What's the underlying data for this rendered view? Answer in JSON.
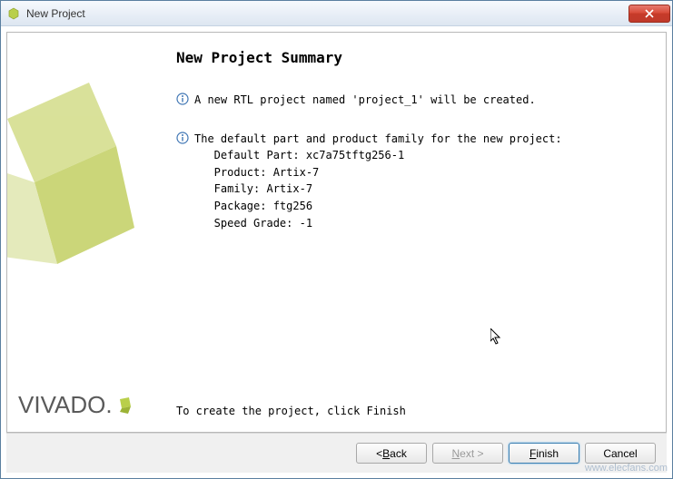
{
  "window": {
    "title": "New Project"
  },
  "content": {
    "heading": "New Project Summary",
    "info1": "A new RTL project named 'project_1' will be created.",
    "info2_line1": "The default part and product family for the new project:",
    "info2_default_part": "   Default Part: xc7a75tftg256-1",
    "info2_product": "   Product: Artix-7",
    "info2_family": "   Family: Artix-7",
    "info2_package": "   Package: ftg256",
    "info2_speed": "   Speed Grade: -1",
    "finish_hint": "To create the project, click Finish"
  },
  "branding": {
    "logo_text": "VIVADO",
    "logo_dot": "."
  },
  "buttons": {
    "back_prefix": "< ",
    "back_u": "B",
    "back_rest": "ack",
    "next_u": "N",
    "next_rest": "ext >",
    "finish_u": "F",
    "finish_rest": "inish",
    "cancel": "Cancel"
  },
  "watermark": {
    "line": "www.elecfans.com"
  }
}
